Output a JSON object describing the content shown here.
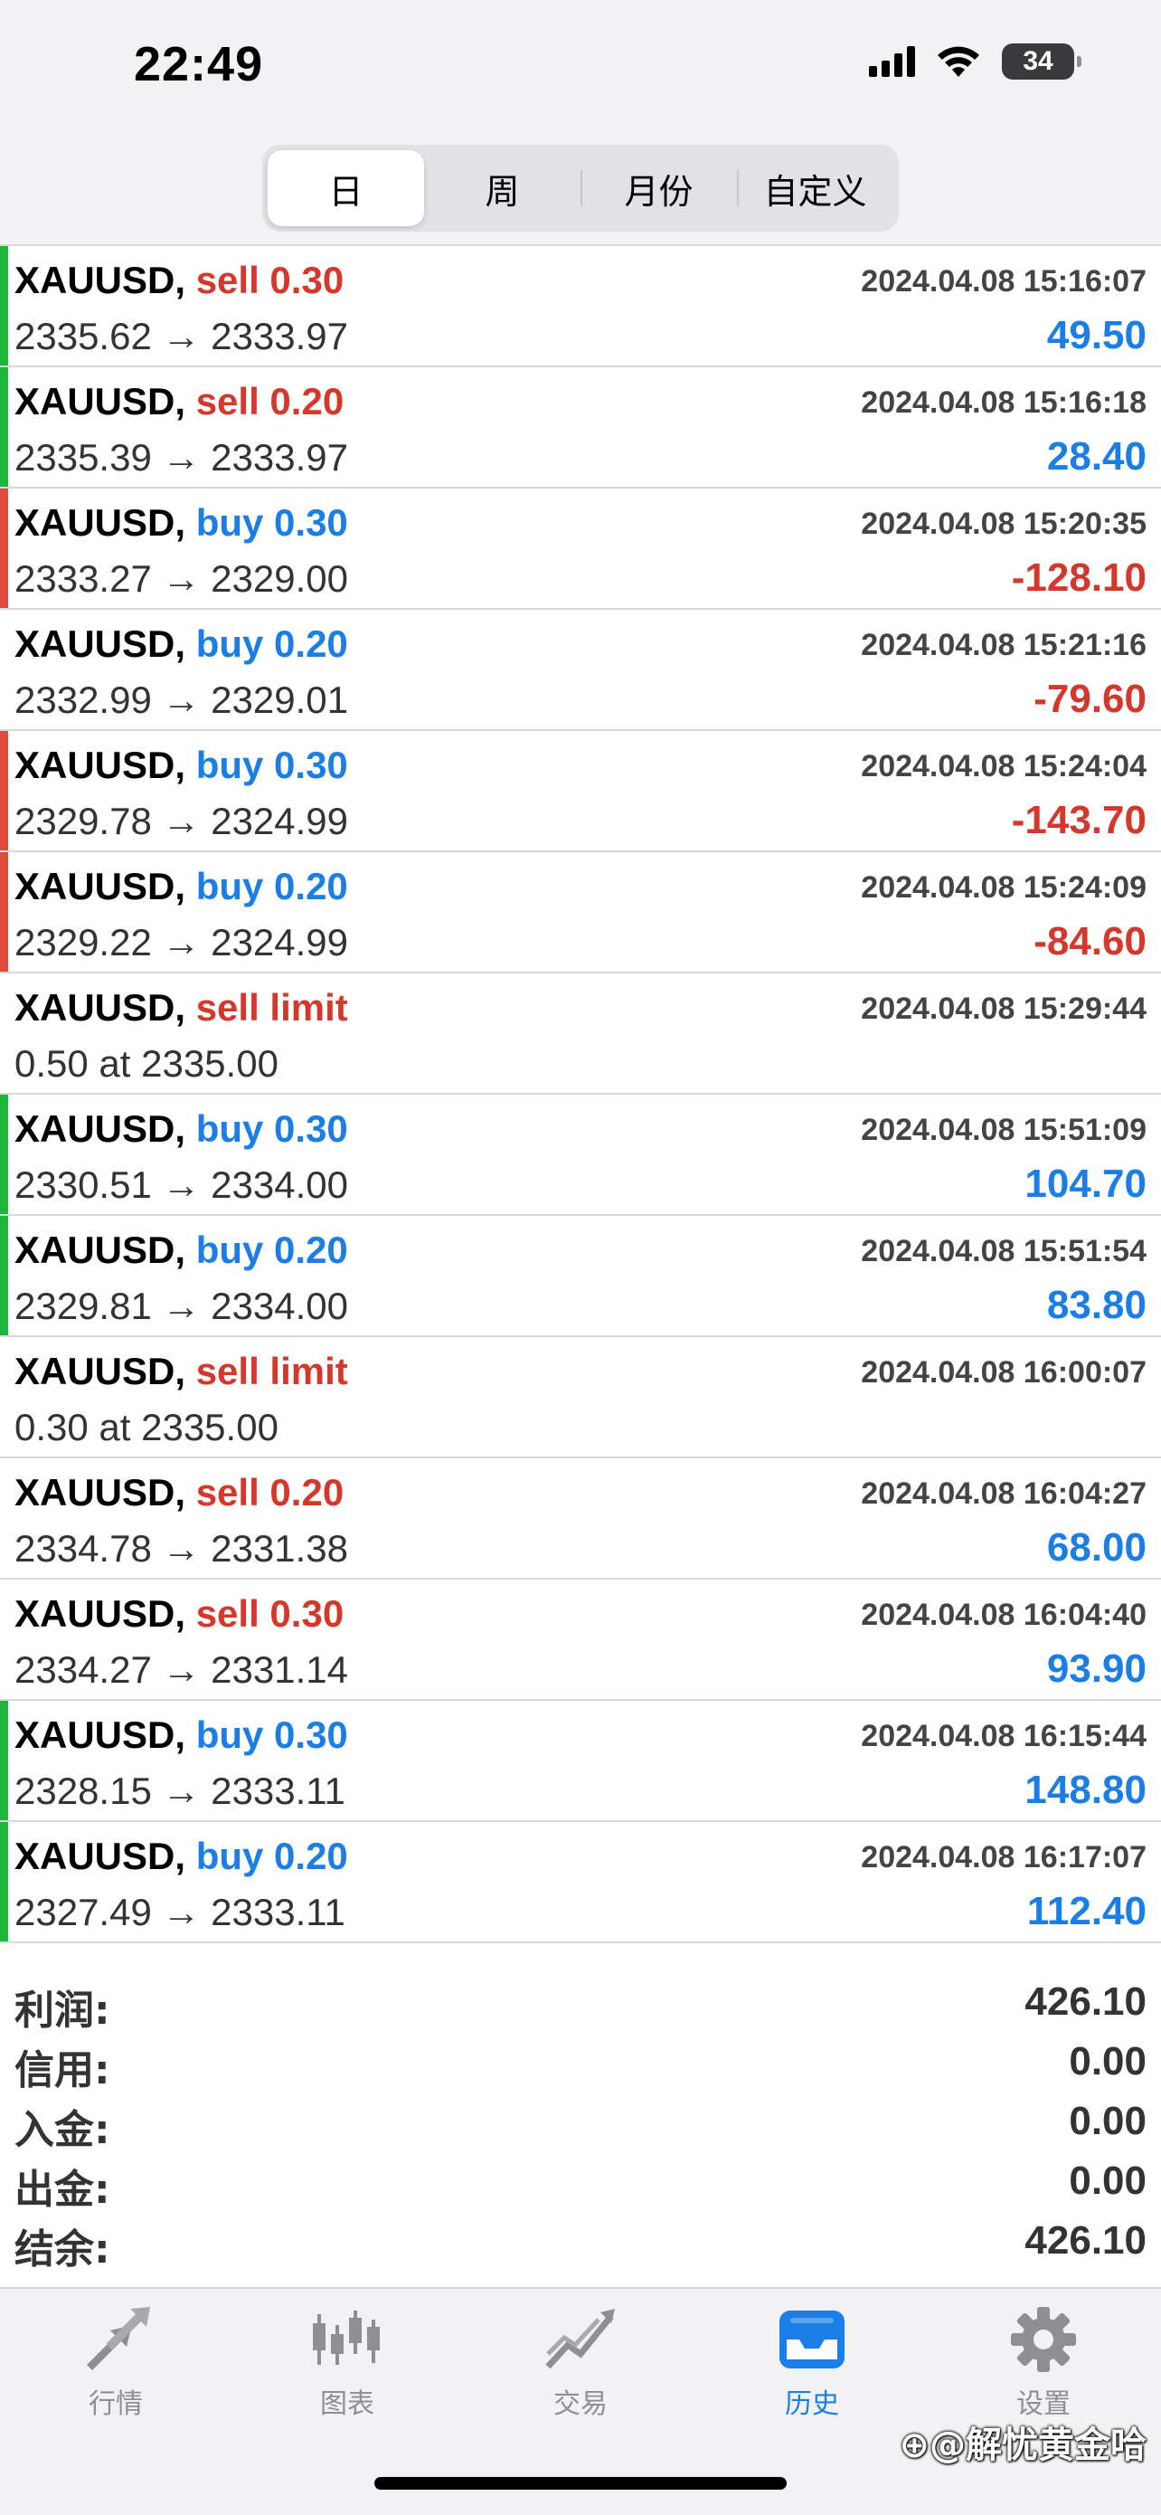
{
  "status_bar": {
    "time": "22:49",
    "battery": "34"
  },
  "period_tabs": [
    "日",
    "周",
    "月份",
    "自定义"
  ],
  "trades": [
    {
      "symbol": "XAUUSD,",
      "type": "sell 0.30",
      "side": "sell",
      "date": "2024.04.08 15:16:07",
      "prices": "2335.62 → 2333.97",
      "profit": "49.50",
      "bar": "green",
      "sign": "pos"
    },
    {
      "symbol": "XAUUSD,",
      "type": "sell 0.20",
      "side": "sell",
      "date": "2024.04.08 15:16:18",
      "prices": "2335.39 → 2333.97",
      "profit": "28.40",
      "bar": "green",
      "sign": "pos"
    },
    {
      "symbol": "XAUUSD,",
      "type": "buy 0.30",
      "side": "buy",
      "date": "2024.04.08 15:20:35",
      "prices": "2333.27 → 2329.00",
      "profit": "-128.10",
      "bar": "red",
      "sign": "neg"
    },
    {
      "symbol": "XAUUSD,",
      "type": "buy 0.20",
      "side": "buy",
      "date": "2024.04.08 15:21:16",
      "prices": "2332.99 → 2329.01",
      "profit": "-79.60",
      "bar": "none",
      "sign": "neg"
    },
    {
      "symbol": "XAUUSD,",
      "type": "buy 0.30",
      "side": "buy",
      "date": "2024.04.08 15:24:04",
      "prices": "2329.78 → 2324.99",
      "profit": "-143.70",
      "bar": "red",
      "sign": "neg"
    },
    {
      "symbol": "XAUUSD,",
      "type": "buy 0.20",
      "side": "buy",
      "date": "2024.04.08 15:24:09",
      "prices": "2329.22 → 2324.99",
      "profit": "-84.60",
      "bar": "red",
      "sign": "neg"
    },
    {
      "symbol": "XAUUSD,",
      "type": "sell limit",
      "side": "sell",
      "date": "2024.04.08 15:29:44",
      "prices": "0.50 at 2335.00",
      "profit": "",
      "bar": "none",
      "sign": "pos"
    },
    {
      "symbol": "XAUUSD,",
      "type": "buy 0.30",
      "side": "buy",
      "date": "2024.04.08 15:51:09",
      "prices": "2330.51 → 2334.00",
      "profit": "104.70",
      "bar": "green",
      "sign": "pos"
    },
    {
      "symbol": "XAUUSD,",
      "type": "buy 0.20",
      "side": "buy",
      "date": "2024.04.08 15:51:54",
      "prices": "2329.81 → 2334.00",
      "profit": "83.80",
      "bar": "green",
      "sign": "pos"
    },
    {
      "symbol": "XAUUSD,",
      "type": "sell limit",
      "side": "sell",
      "date": "2024.04.08 16:00:07",
      "prices": "0.30 at 2335.00",
      "profit": "",
      "bar": "none",
      "sign": "pos"
    },
    {
      "symbol": "XAUUSD,",
      "type": "sell 0.20",
      "side": "sell",
      "date": "2024.04.08 16:04:27",
      "prices": "2334.78 → 2331.38",
      "profit": "68.00",
      "bar": "none",
      "sign": "pos"
    },
    {
      "symbol": "XAUUSD,",
      "type": "sell 0.30",
      "side": "sell",
      "date": "2024.04.08 16:04:40",
      "prices": "2334.27 → 2331.14",
      "profit": "93.90",
      "bar": "none",
      "sign": "pos"
    },
    {
      "symbol": "XAUUSD,",
      "type": "buy 0.30",
      "side": "buy",
      "date": "2024.04.08 16:15:44",
      "prices": "2328.15 → 2333.11",
      "profit": "148.80",
      "bar": "green",
      "sign": "pos"
    },
    {
      "symbol": "XAUUSD,",
      "type": "buy 0.20",
      "side": "buy",
      "date": "2024.04.08 16:17:07",
      "prices": "2327.49 → 2333.11",
      "profit": "112.40",
      "bar": "green",
      "sign": "pos"
    }
  ],
  "summary": [
    {
      "label": "利润:",
      "value": "426.10"
    },
    {
      "label": "信用:",
      "value": "0.00"
    },
    {
      "label": "入金:",
      "value": "0.00"
    },
    {
      "label": "出金:",
      "value": "0.00"
    },
    {
      "label": "结余:",
      "value": "426.10"
    }
  ],
  "tabbar": [
    {
      "label": "行情",
      "icon": "quotes-arrows-icon"
    },
    {
      "label": "图表",
      "icon": "candlestick-chart-icon"
    },
    {
      "label": "交易",
      "icon": "trade-trend-icon"
    },
    {
      "label": "历史",
      "icon": "history-inbox-icon",
      "active": true
    },
    {
      "label": "设置",
      "icon": "gear-icon"
    }
  ],
  "watermark": "⊕@解忧黄金哈",
  "colors": {
    "positive": "#1a7ee6",
    "negative": "#d5372b",
    "green_bar": "#1db83a",
    "red_bar": "#e04a3c"
  }
}
